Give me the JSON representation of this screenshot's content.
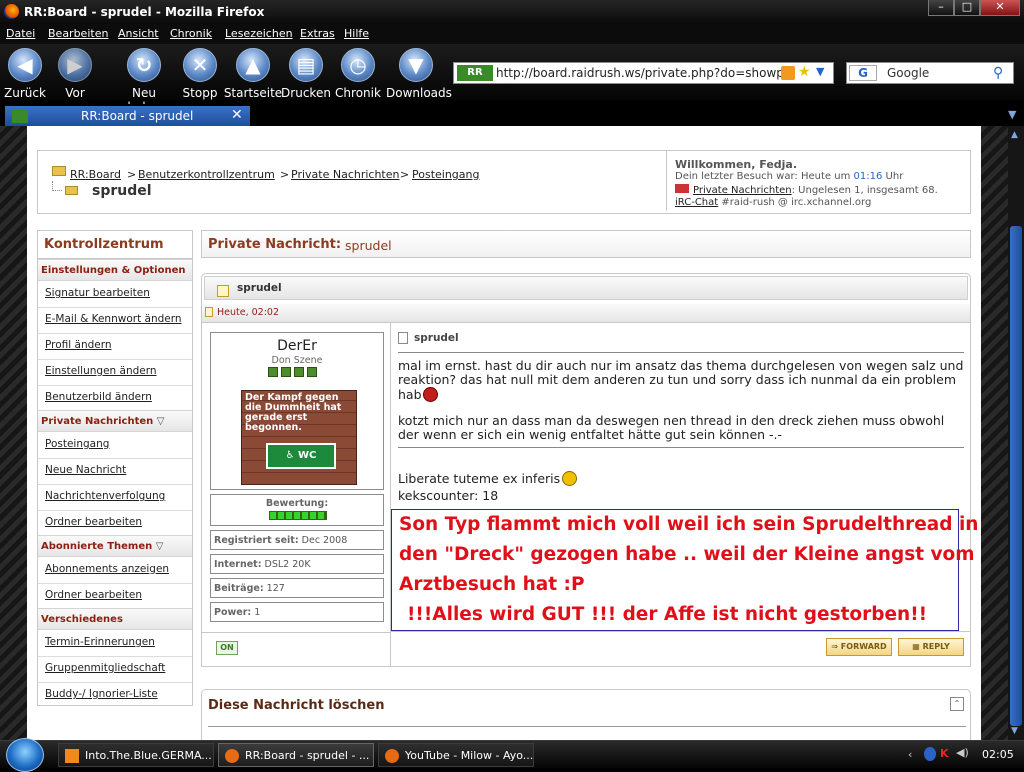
{
  "window": {
    "title": "RR:Board - sprudel - Mozilla Firefox"
  },
  "menu": [
    "Datei",
    "Bearbeiten",
    "Ansicht",
    "Chronik",
    "Lesezeichen",
    "Extras",
    "Hilfe"
  ],
  "nav": {
    "back": "Zurück",
    "forward": "Vor",
    "reload": "Neu laden",
    "stop": "Stopp",
    "home": "Startseite",
    "print": "Drucken",
    "history": "Chronik",
    "downloads": "Downloads"
  },
  "url": "http://board.raidrush.ws/private.php?do=showpm&p",
  "search": {
    "engine": "Google"
  },
  "tab": {
    "label": "RR:Board - sprudel"
  },
  "breadcrumb": {
    "items": [
      "RR:Board",
      "Benutzerkontrollzentrum",
      "Private Nachrichten",
      "Posteingang"
    ],
    "sep": ">",
    "current": "sprudel"
  },
  "welcome": {
    "line1": "Willkommen, Fedja.",
    "last_visit_pre": "Dein letzter Besuch war: Heute um",
    "last_visit_time": "01:16",
    "last_visit_post": "Uhr",
    "pm_link": "Private Nachrichten",
    "pm_text": ": Ungelesen 1, insgesamt 68.",
    "irc_link": "iRC-Chat",
    "irc_text": "#raid-rush @ irc.xchannel.org"
  },
  "sidebar": {
    "title": "Kontrollzentrum",
    "sections": [
      {
        "label": "Einstellungen & Optionen",
        "items": [
          "Signatur bearbeiten",
          "E-Mail & Kennwort ändern",
          "Profil ändern",
          "Einstellungen ändern",
          "Benutzerbild ändern"
        ]
      },
      {
        "label": "Private Nachrichten",
        "items": [
          "Posteingang",
          "Neue Nachricht",
          "Nachrichtenverfolgung",
          "Ordner bearbeiten"
        ]
      },
      {
        "label": "Abonnierte Themen",
        "items": [
          "Abonnements anzeigen",
          "Ordner bearbeiten"
        ]
      },
      {
        "label": "Verschiedenes",
        "items": [
          "Termin-Erinnerungen",
          "Gruppenmitgliedschaft",
          "Buddy-/ Ignorier-Liste"
        ]
      }
    ]
  },
  "pm_title": {
    "label": "Private Nachricht:",
    "subject": "sprudel"
  },
  "message": {
    "header": "sprudel",
    "date": "Heute, 02:02",
    "author": "DerEr",
    "rank": "Don Szene",
    "avatar_text": "Der Kampf gegen die Dummheit hat gerade erst begonnen.",
    "avatar_sign": "WC",
    "rating_label": "Bewertung:",
    "info": [
      {
        "label": "Registriert seit:",
        "value": "Dec 2008"
      },
      {
        "label": "Internet:",
        "value": "DSL2 20K"
      },
      {
        "label": "Beiträge:",
        "value": "127"
      },
      {
        "label": "Power:",
        "value": "1"
      }
    ],
    "subject": "sprudel",
    "body1": "mal im ernst. hast du dir auch nur im ansatz das thema durchgelesen von wegen salz und reaktion? das hat null mit dem anderen zu tun und sorry dass ich nunmal da ein problem hab",
    "body2": "kotzt mich nur an dass man da deswegen nen thread in den dreck ziehen muss obwohl der wenn er sich ein wenig entfaltet hätte gut sein können -.-",
    "sig1": "Liberate tuteme ex inferis",
    "sig2": "kekscounter: 18",
    "status": "ON",
    "forward": "FORWARD",
    "reply": "REPLY"
  },
  "annotation": [
    "Son Typ flammt mich voll weil ich sein Sprudelthread in",
    "den \"Dreck\" gezogen habe .. weil der Kleine angst vom",
    "Arztbesuch hat :P",
    "!!!Alles wird GUT !!! der Affe ist nicht gestorben!!"
  ],
  "delete_box": {
    "title": "Diese Nachricht löschen"
  },
  "taskbar": {
    "tasks": [
      "Into.The.Blue.GERMA...",
      "RR:Board - sprudel - ...",
      "YouTube - Milow - Ayo..."
    ],
    "clock": "02:05"
  },
  "colors": {
    "accent": "#8b3b1f",
    "annotation": "#e0101a",
    "link_blue": "#2b62c7"
  }
}
